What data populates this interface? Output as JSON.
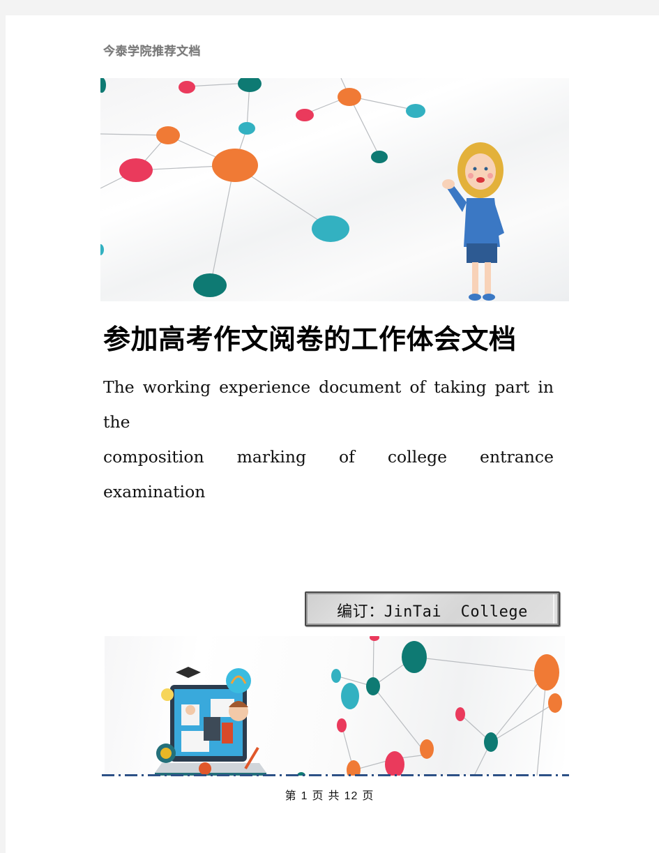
{
  "header": {
    "org_name": "今泰学院推荐文档"
  },
  "hero_image": {
    "description": "network-nodes-illustration-with-cartoon-teacher",
    "node_colors": {
      "orange": "#f07a35",
      "red": "#ea3a5c",
      "teal": "#0e7a73",
      "cyan": "#33b1c1"
    }
  },
  "document": {
    "title": "参加高考作文阅卷的工作体会文档",
    "subtitle_line1": "The working experience document of taking part in the",
    "subtitle_line2": "composition marking of college entrance examination"
  },
  "editor_label": {
    "prefix": "编订：",
    "name": "JinTai  College"
  },
  "bottom_image": {
    "description": "online-education-laptop-illustration-with-network-nodes"
  },
  "footer": {
    "page_prefix": "第",
    "current_page": "1",
    "page_word": "页",
    "total_prefix": "共",
    "total_pages": "12",
    "total_suffix": "页"
  },
  "colors": {
    "divider": "#2c5085",
    "header_text": "#7a7a7a"
  }
}
